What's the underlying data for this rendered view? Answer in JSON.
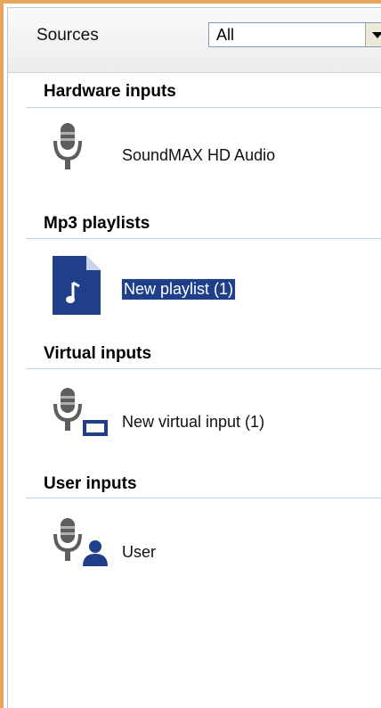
{
  "header": {
    "label": "Sources",
    "combo_value": "All"
  },
  "sections": [
    {
      "title": "Hardware inputs",
      "item": "SoundMAX HD Audio",
      "icon": "microphone-icon"
    },
    {
      "title": "Mp3 playlists",
      "item": "New playlist (1)",
      "icon": "playlist-file-icon",
      "selected": true
    },
    {
      "title": "Virtual inputs",
      "item": "New virtual input (1)",
      "icon": "virtual-microphone-icon"
    },
    {
      "title": "User inputs",
      "item": "User",
      "icon": "user-microphone-icon"
    }
  ],
  "colors": {
    "accent_border": "#e7a65a",
    "selection": "#1f3f8a",
    "icon": "#5e5e5e"
  }
}
